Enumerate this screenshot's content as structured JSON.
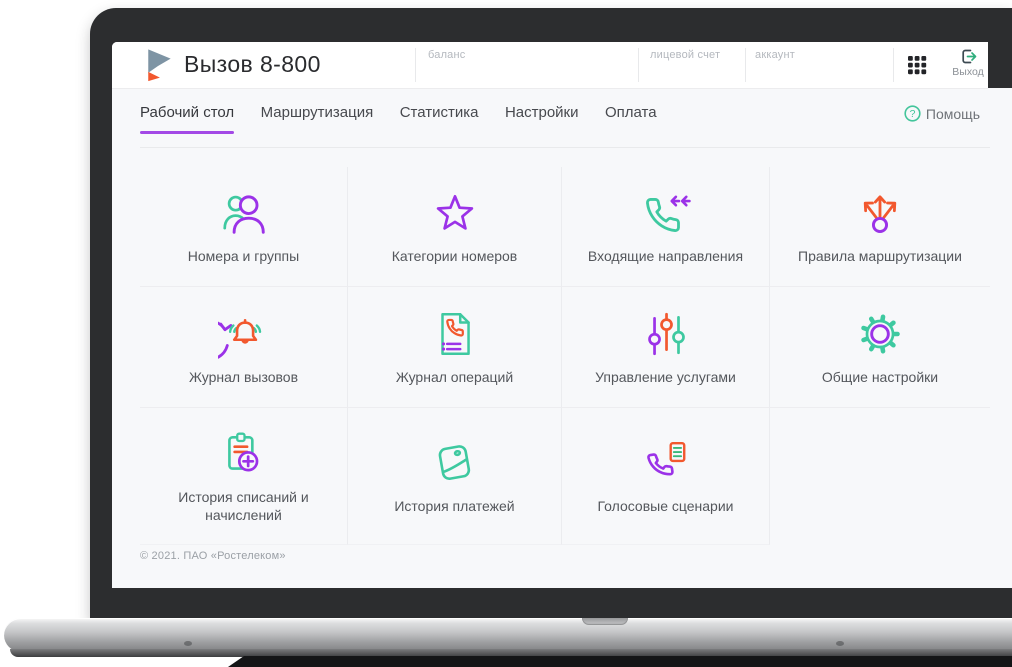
{
  "app": {
    "title": "Вызов 8-800"
  },
  "header": {
    "fields": [
      {
        "label": "баланс"
      },
      {
        "label": "лицевой счет"
      },
      {
        "label": "аккаунт"
      }
    ],
    "apps_icon": "apps-grid-icon",
    "logout": {
      "label": "Выход",
      "icon": "logout-icon"
    }
  },
  "nav": {
    "tabs": [
      {
        "label": "Рабочий стол",
        "active": true
      },
      {
        "label": "Маршрутизация",
        "active": false
      },
      {
        "label": "Статистика",
        "active": false
      },
      {
        "label": "Настройки",
        "active": false
      },
      {
        "label": "Оплата",
        "active": false
      }
    ],
    "help": {
      "label": "Помощь",
      "icon": "question-circle-icon"
    }
  },
  "tiles": [
    {
      "label": "Номера и группы",
      "icon": "users-icon"
    },
    {
      "label": "Категории номеров",
      "icon": "star-icon"
    },
    {
      "label": "Входящие направления",
      "icon": "phone-incoming-icon"
    },
    {
      "label": "Правила маршрутизации",
      "icon": "route-split-icon"
    },
    {
      "label": "Журнал вызовов",
      "icon": "call-history-icon"
    },
    {
      "label": "Журнал операций",
      "icon": "operations-log-icon"
    },
    {
      "label": "Управление услугами",
      "icon": "sliders-icon"
    },
    {
      "label": "Общие настройки",
      "icon": "gear-icon"
    },
    {
      "label": "История списаний и начислений",
      "icon": "clipboard-plus-icon"
    },
    {
      "label": "История платежей",
      "icon": "wallet-icon"
    },
    {
      "label": "Голосовые сценарии",
      "icon": "voice-script-icon"
    }
  ],
  "footer": {
    "copyright": "© 2021. ПАО «Ростелеком»"
  },
  "colors": {
    "accent_purple": "#9b32e8",
    "accent_teal": "#3ec9a0",
    "accent_orange": "#f2582e",
    "help_green": "#43c59b",
    "bezel": "#2c2d2f",
    "page_bg": "#f7f8fa"
  }
}
